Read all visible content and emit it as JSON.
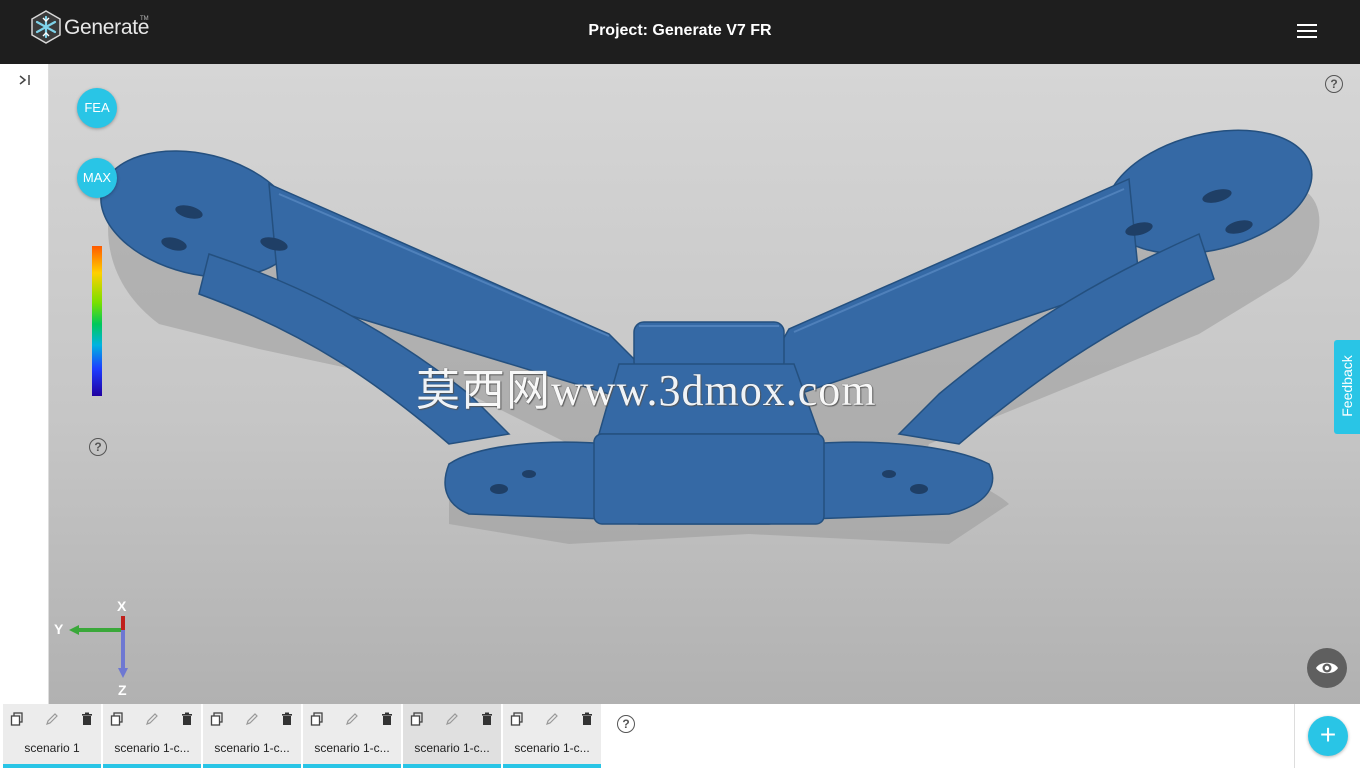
{
  "app": {
    "logo_text": "Generate",
    "logo_tm": "TM"
  },
  "header": {
    "title": "Project: Generate V7 FR"
  },
  "viewport": {
    "fea_label": "FEA",
    "max_label": "MAX",
    "help_glyph": "?",
    "feedback_label": "Feedback",
    "watermark": "莫西网www.3dmox.com",
    "axes": {
      "x": "X",
      "y": "Y",
      "z": "Z"
    },
    "colors": {
      "accent": "#29c5e6",
      "model": "#3569a5"
    }
  },
  "scenarios": [
    {
      "label": "scenario 1",
      "active": false
    },
    {
      "label": "scenario 1-c...",
      "active": false
    },
    {
      "label": "scenario 1-c...",
      "active": false
    },
    {
      "label": "scenario 1-c...",
      "active": false
    },
    {
      "label": "scenario 1-c...",
      "active": true
    },
    {
      "label": "scenario 1-c...",
      "active": false
    }
  ],
  "add_glyph": "+"
}
